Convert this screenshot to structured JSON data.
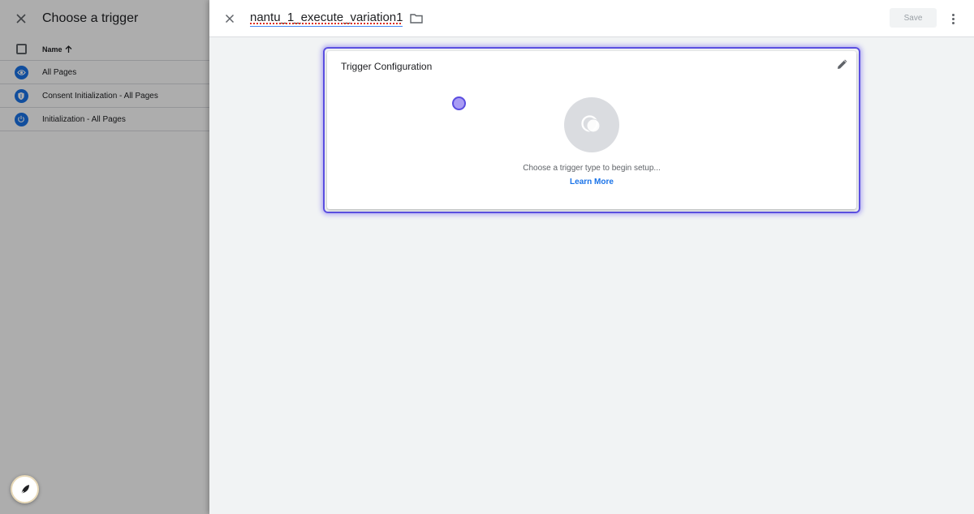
{
  "left_panel": {
    "title": "Choose a trigger",
    "column_name": "Name",
    "triggers": [
      {
        "label": "All Pages",
        "icon": "eye-icon"
      },
      {
        "label": "Consent Initialization - All Pages",
        "icon": "shield-icon"
      },
      {
        "label": "Initialization - All Pages",
        "icon": "power-icon"
      }
    ]
  },
  "topbar": {
    "tag_name": "nantu_1_execute_variation1",
    "save_label": "Save"
  },
  "card": {
    "title": "Trigger Configuration",
    "hint": "Choose a trigger type to begin setup...",
    "learn_more": "Learn More"
  },
  "colors": {
    "accent_blue": "#1a73e8",
    "focus_ring": "#5b4fe0",
    "cursor": "#a99cf4"
  }
}
